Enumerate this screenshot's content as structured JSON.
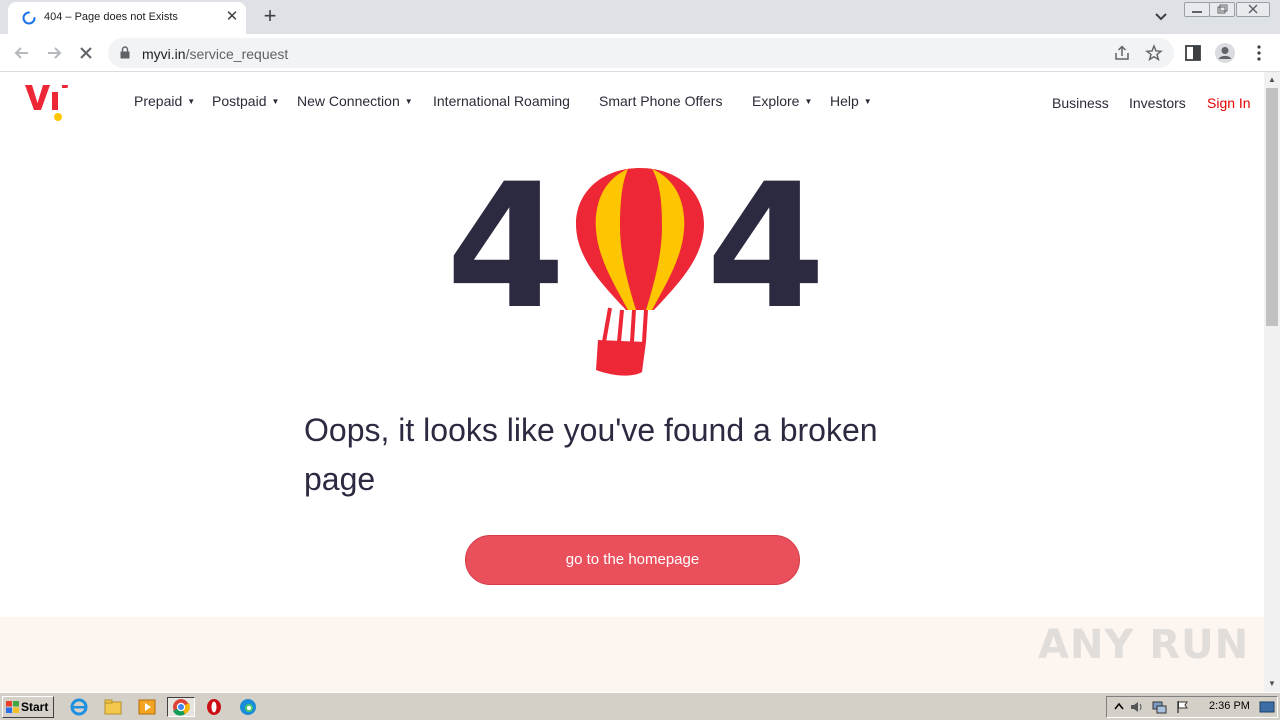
{
  "browser": {
    "tab_title": "404 – Page does not Exists",
    "url_domain": "myvi.in",
    "url_path": "/service_request"
  },
  "nav": {
    "items": [
      {
        "label": "Prepaid",
        "has_dropdown": true
      },
      {
        "label": "Postpaid",
        "has_dropdown": true
      },
      {
        "label": "New Connection",
        "has_dropdown": true
      },
      {
        "label": "International Roaming",
        "has_dropdown": false
      },
      {
        "label": "Smart Phone Offers",
        "has_dropdown": false
      },
      {
        "label": "Explore",
        "has_dropdown": true
      },
      {
        "label": "Help",
        "has_dropdown": true
      }
    ],
    "right": {
      "business": "Business",
      "investors": "Investors",
      "sign_in": "Sign In"
    }
  },
  "error": {
    "digit_left": "4",
    "digit_right": "4",
    "message": "Oops, it looks like you've found a broken page",
    "button_label": "go to the homepage"
  },
  "colors": {
    "brand_red": "#e60000",
    "button": "#ea4f5c",
    "balloon_red": "#ee2737",
    "balloon_yellow": "#fec600",
    "digit": "#2b2a41"
  },
  "watermark": "ANY RUN",
  "taskbar": {
    "start_label": "Start",
    "clock": "2:36 PM"
  }
}
